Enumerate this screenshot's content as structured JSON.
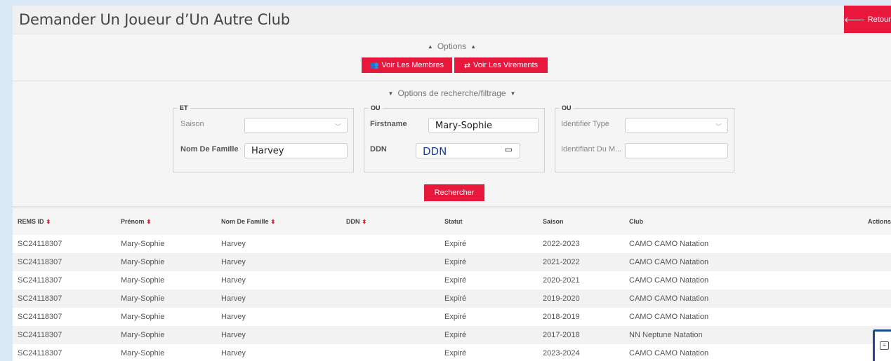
{
  "header": {
    "title": "Demander Un Joueur d’Un Autre Club",
    "back_label": "Retour"
  },
  "options": {
    "toggle_label": "Options",
    "members_label": "Voir Les Membres",
    "transfers_label": "Voir Les Virements"
  },
  "search": {
    "toggle_label": "Options de recherche/filtrage",
    "group1": {
      "legend": "ET",
      "season_label": "Saison",
      "season_value": "",
      "lastname_label": "Nom De Famille",
      "lastname_value": "Harvey"
    },
    "group2": {
      "legend": "OU",
      "firstname_label": "Firstname",
      "firstname_value": "Mary-Sophie",
      "dob_label": "DDN",
      "dob_value": "DDN"
    },
    "group3": {
      "legend": "OU",
      "idtype_label": "Identifier Type",
      "idtype_value": "",
      "memberid_label": "Identifiant Du M...",
      "memberid_value": ""
    },
    "submit_label": "Rechercher"
  },
  "table": {
    "columns": [
      "REMS ID",
      "Prénom",
      "Nom De Famille",
      "DDN",
      "Statut",
      "Saison",
      "Club",
      "Actions"
    ],
    "rows": [
      [
        "SC24118307",
        "Mary-Sophie",
        "Harvey",
        "",
        "Expiré",
        "2022-2023",
        "CAMO CAMO Natation"
      ],
      [
        "SC24118307",
        "Mary-Sophie",
        "Harvey",
        "",
        "Expiré",
        "2021-2022",
        "CAMO CAMO Natation"
      ],
      [
        "SC24118307",
        "Mary-Sophie",
        "Harvey",
        "",
        "Expiré",
        "2020-2021",
        "CAMO CAMO Natation"
      ],
      [
        "SC24118307",
        "Mary-Sophie",
        "Harvey",
        "",
        "Expiré",
        "2019-2020",
        "CAMO CAMO Natation"
      ],
      [
        "SC24118307",
        "Mary-Sophie",
        "Harvey",
        "",
        "Expiré",
        "2018-2019",
        "CAMO CAMO Natation"
      ],
      [
        "SC24118307",
        "Mary-Sophie",
        "Harvey",
        "",
        "Expiré",
        "2017-2018",
        "NN Neptune Natation"
      ],
      [
        "SC24118307",
        "Mary-Sophie",
        "Harvey",
        "",
        "Expiré",
        "2023-2024",
        "CAMO CAMO Natation"
      ]
    ]
  },
  "colors": {
    "accent": "#e8173c",
    "fab_border": "#1d4a8c"
  },
  "icons": {
    "back": "arrow-left-icon",
    "members": "users-icon",
    "transfers": "exchange-icon",
    "sort": "sort-icon",
    "calendar": "calendar-icon",
    "fab": "chat-icon"
  }
}
